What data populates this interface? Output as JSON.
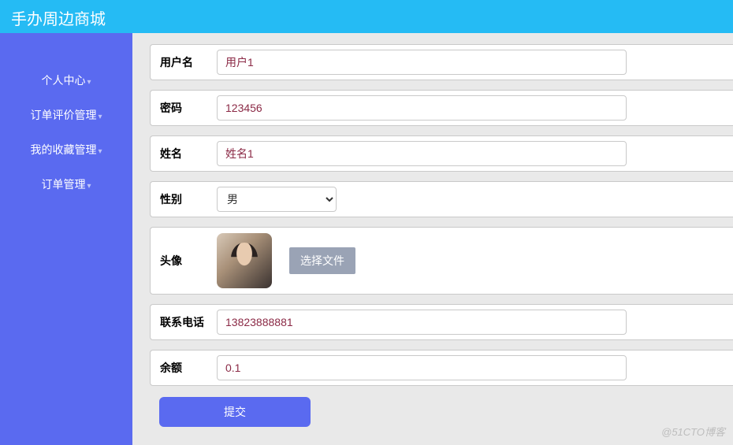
{
  "header": {
    "title": "手办周边商城"
  },
  "sidebar": {
    "items": [
      {
        "label": "个人中心"
      },
      {
        "label": "订单评价管理"
      },
      {
        "label": "我的收藏管理"
      },
      {
        "label": "订单管理"
      }
    ]
  },
  "form": {
    "username": {
      "label": "用户名",
      "value": "用户1"
    },
    "password": {
      "label": "密码",
      "value": "123456"
    },
    "realname": {
      "label": "姓名",
      "value": "姓名1"
    },
    "gender": {
      "label": "性别",
      "value": "男"
    },
    "avatar": {
      "label": "头像",
      "button": "选择文件"
    },
    "phone": {
      "label": "联系电话",
      "value": "13823888881"
    },
    "balance": {
      "label": "余额",
      "value": "0.1"
    },
    "submit": "提交"
  },
  "watermark": "@51CTO博客"
}
